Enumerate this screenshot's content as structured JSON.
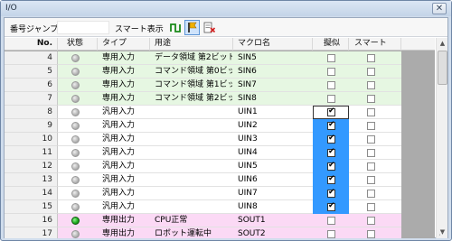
{
  "window": {
    "title": "I/O",
    "close_glyph": "✕"
  },
  "toolbar": {
    "jump_label": "番号ジャンプ",
    "jump_value": "",
    "smart_label": "スマート表示",
    "buttons": [
      "pulse-icon",
      "flag-icon",
      "clear-icon"
    ]
  },
  "columns": {
    "no": "No.",
    "status": "状態",
    "type": "タイプ",
    "use": "用途",
    "macro": "マクロ名",
    "sim": "擬似",
    "smart": "スマート"
  },
  "colors": {
    "input_row": "#e6f7e2",
    "general_row": "#ffffff",
    "output_row": "#fbd9f5",
    "led_off": "#b4b4b4",
    "led_on": "#1fae1f",
    "selection": "#3399ff"
  },
  "rows": [
    {
      "no": "4",
      "type": "専用入力",
      "use": "データ領域 第2ビット",
      "macro": "SIN5",
      "sim": false,
      "smart": false,
      "group": "input",
      "led": "off"
    },
    {
      "no": "5",
      "type": "専用入力",
      "use": "コマンド領域 第0ビッ",
      "macro": "SIN6",
      "sim": false,
      "smart": false,
      "group": "input",
      "led": "off"
    },
    {
      "no": "6",
      "type": "専用入力",
      "use": "コマンド領域 第1ビッ",
      "macro": "SIN7",
      "sim": false,
      "smart": false,
      "group": "input",
      "led": "off"
    },
    {
      "no": "7",
      "type": "専用入力",
      "use": "コマンド領域 第2ビッ",
      "macro": "SIN8",
      "sim": false,
      "smart": false,
      "group": "input",
      "led": "off"
    },
    {
      "no": "8",
      "type": "汎用入力",
      "use": "",
      "macro": "UIN1",
      "sim": true,
      "smart": false,
      "group": "general",
      "led": "off",
      "sim_cell": "focused"
    },
    {
      "no": "9",
      "type": "汎用入力",
      "use": "",
      "macro": "UIN2",
      "sim": true,
      "smart": false,
      "group": "general",
      "led": "off",
      "sim_cell": "selected"
    },
    {
      "no": "10",
      "type": "汎用入力",
      "use": "",
      "macro": "UIN3",
      "sim": true,
      "smart": false,
      "group": "general",
      "led": "off",
      "sim_cell": "selected"
    },
    {
      "no": "11",
      "type": "汎用入力",
      "use": "",
      "macro": "UIN4",
      "sim": true,
      "smart": false,
      "group": "general",
      "led": "off",
      "sim_cell": "selected"
    },
    {
      "no": "12",
      "type": "汎用入力",
      "use": "",
      "macro": "UIN5",
      "sim": true,
      "smart": false,
      "group": "general",
      "led": "off",
      "sim_cell": "selected"
    },
    {
      "no": "13",
      "type": "汎用入力",
      "use": "",
      "macro": "UIN6",
      "sim": true,
      "smart": false,
      "group": "general",
      "led": "off",
      "sim_cell": "selected"
    },
    {
      "no": "14",
      "type": "汎用入力",
      "use": "",
      "macro": "UIN7",
      "sim": true,
      "smart": false,
      "group": "general",
      "led": "off",
      "sim_cell": "selected"
    },
    {
      "no": "15",
      "type": "汎用入力",
      "use": "",
      "macro": "UIN8",
      "sim": true,
      "smart": false,
      "group": "general",
      "led": "off",
      "sim_cell": "selected"
    },
    {
      "no": "16",
      "type": "専用出力",
      "use": "CPU正常",
      "macro": "SOUT1",
      "sim": false,
      "smart": false,
      "group": "output",
      "led": "on"
    },
    {
      "no": "17",
      "type": "専用出力",
      "use": "ロボット運転中",
      "macro": "SOUT2",
      "sim": false,
      "smart": false,
      "group": "output",
      "led": "off"
    }
  ],
  "scrollbar": {
    "up_glyph": "▲",
    "down_glyph": "▼",
    "grip_glyph": "⋰"
  }
}
